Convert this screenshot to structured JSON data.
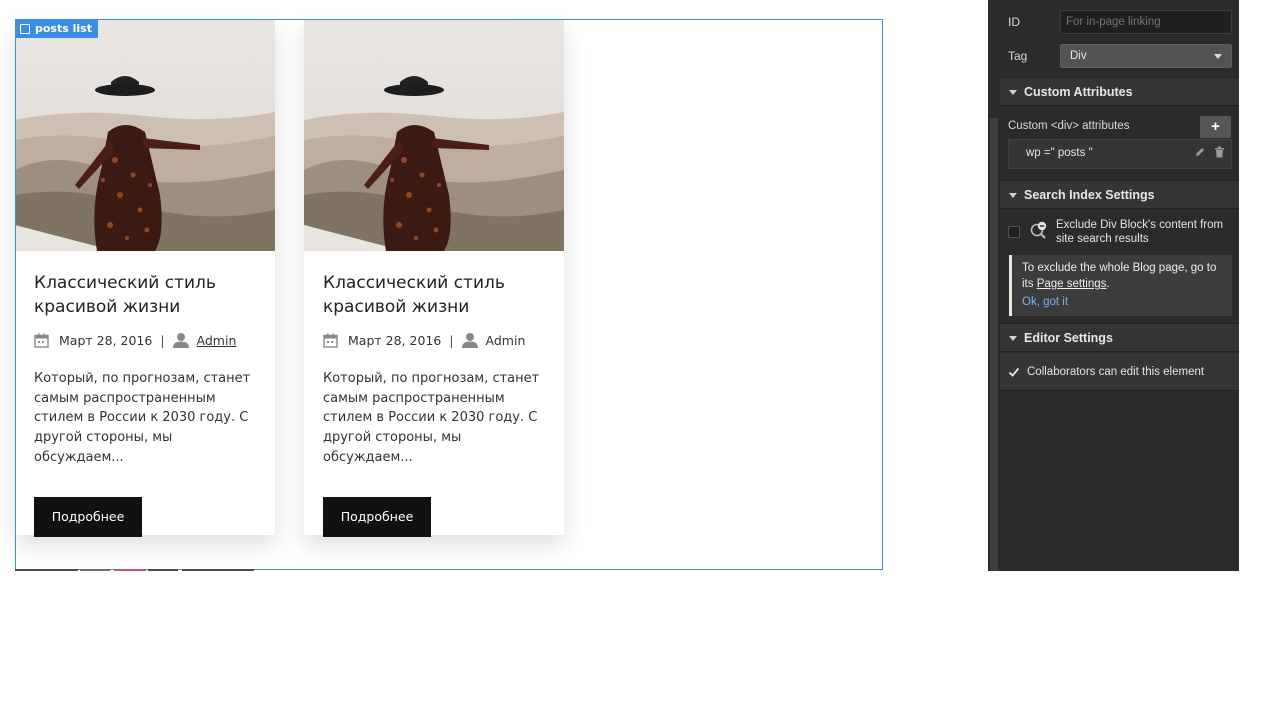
{
  "canvas": {
    "selection_label": "posts list",
    "cards": [
      {
        "title": "Классический стиль красивой жизни",
        "date": "Март 28, 2016",
        "separator": "|",
        "author": "Admin",
        "excerpt": "Который, по прогнозам, станет самым распространенным стилем в России к 2030 году. С другой стороны, мы обсуждаем...",
        "button": "Подробнее"
      },
      {
        "title": "Классический стиль красивой жизни",
        "date": "Март 28, 2016",
        "separator": "|",
        "author": "Admin",
        "excerpt": "Который, по прогнозам, станет самым распространенным стилем в России к 2030 году. С другой стороны, мы обсуждаем...",
        "button": "Подробнее"
      }
    ]
  },
  "panel": {
    "id_label": "ID",
    "id_placeholder": "For in-page linking",
    "tag_label": "Tag",
    "tag_value": "Div",
    "custom_attributes": {
      "header": "Custom Attributes",
      "subtitle": "Custom <div> attributes",
      "add_label": "+",
      "attribute": "wp =\" posts \""
    },
    "search_index": {
      "header": "Search Index Settings",
      "exclude_label": "Exclude Div Block's content from site search results",
      "note_text": "To exclude the whole Blog page, go to its",
      "note_link": "Page settings",
      "note_end": ".",
      "note_ok": "Ok, got it"
    },
    "editor_settings": {
      "header": "Editor Settings",
      "collaborators_label": "Collaborators can edit this element"
    }
  },
  "colors": {
    "selection_blue": "#3b8ee8",
    "panel_bg": "#2b2b2b",
    "button_dark": "#111111",
    "link_blue": "#77b3f0"
  }
}
